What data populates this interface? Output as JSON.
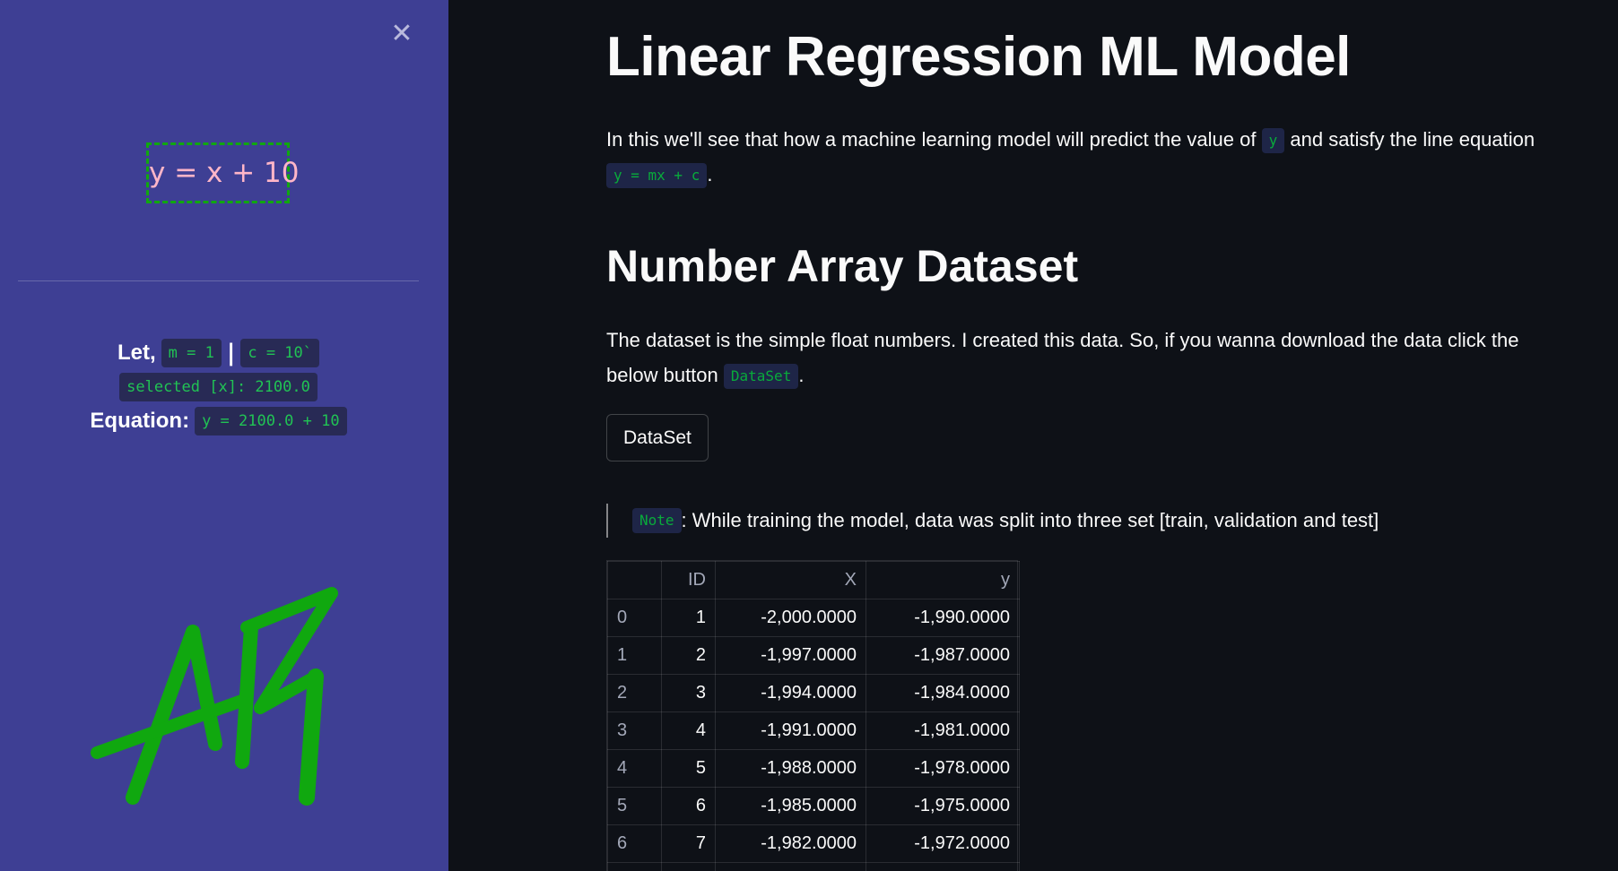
{
  "sidebar": {
    "close_icon": "close-icon",
    "equation_box": "y = x + 10",
    "let_label": "Let,",
    "m_code": "m = 1",
    "separator": "|",
    "c_code": "c = 10`",
    "selected_code": "selected [x]: 2100.0",
    "equation_label": "Equation:",
    "equation_code": "y = 2100.0 + 10",
    "logo_text": "AR"
  },
  "main": {
    "title": "Linear Regression ML Model",
    "intro": {
      "before_y": "In this we'll see that how a machine learning model will predict the value of",
      "y_code": "y",
      "after_y": "and satisfy the line equation",
      "eq_code": "y = mx + c",
      "end": "."
    },
    "dataset_heading": "Number Array Dataset",
    "dataset_para": {
      "text": "The dataset is the simple float numbers. I created this data. So, if you wanna download the data click the below button",
      "code": "DataSet",
      "end": "."
    },
    "dataset_button": "DataSet",
    "note": {
      "code": "Note",
      "text": ": While training the model, data was split into three set [train, validation and test]"
    },
    "table": {
      "columns": [
        "",
        "ID",
        "X",
        "y"
      ],
      "rows": [
        [
          "0",
          "1",
          "-2,000.0000",
          "-1,990.0000"
        ],
        [
          "1",
          "2",
          "-1,997.0000",
          "-1,987.0000"
        ],
        [
          "2",
          "3",
          "-1,994.0000",
          "-1,984.0000"
        ],
        [
          "3",
          "4",
          "-1,991.0000",
          "-1,981.0000"
        ],
        [
          "4",
          "5",
          "-1,988.0000",
          "-1,978.0000"
        ],
        [
          "5",
          "6",
          "-1,985.0000",
          "-1,975.0000"
        ],
        [
          "6",
          "7",
          "-1,982.0000",
          "-1,972.0000"
        ],
        [
          "",
          "",
          "",
          ""
        ]
      ]
    }
  },
  "colors": {
    "sidebar_bg": "#3e3f94",
    "main_bg": "#0e1117",
    "code_green": "#09ab3b",
    "equation_pink": "#ffb6c8",
    "logo_green": "#10a80f"
  }
}
